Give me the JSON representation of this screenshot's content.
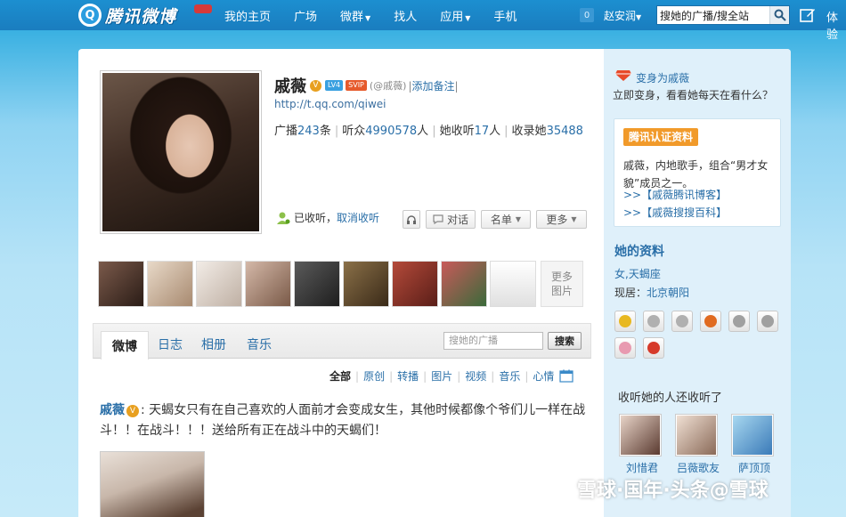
{
  "topbar": {
    "logo_text": "腾讯微博",
    "nav": [
      "我的主页",
      "广场",
      "微群",
      "找人",
      "应用",
      "手机"
    ],
    "nav_dropdowns": [
      false,
      false,
      true,
      false,
      true,
      false
    ],
    "notification_count": "0",
    "user_name": "赵安润",
    "search_value": "搜她的广播/搜全站",
    "experience_label": "体验"
  },
  "profile": {
    "name": "戚薇",
    "level_badge": "LV4",
    "vip_badge": "SVIP",
    "handle": "(@戚薇)",
    "add_note": "添加备注",
    "url": "http://t.qq.com/qiwei",
    "stats": [
      {
        "label": "广播",
        "value": "243",
        "unit": "条"
      },
      {
        "label": "听众",
        "value": "4990578",
        "unit": "人"
      },
      {
        "label": "她收听",
        "value": "17",
        "unit": "人"
      },
      {
        "label": "收录她",
        "value": "35488",
        "unit": ""
      }
    ],
    "follow_status": "已收听",
    "unfollow": "取消收听",
    "buttons": {
      "chat": "对话",
      "list": "名单",
      "more": "更多"
    }
  },
  "photos": {
    "more_line1": "更多",
    "more_line2": "图片",
    "tints": [
      "#7b5a4b",
      "#c9b6a3",
      "#d8cfc8",
      "#a88978",
      "#3d3a3a",
      "#6d5a3c",
      "#8e3a2f",
      "#a64a4a",
      "#f1f1f1"
    ]
  },
  "tabs": {
    "items": [
      "微博",
      "日志",
      "相册",
      "音乐"
    ],
    "active": 0,
    "search_placeholder": "搜她的广播",
    "search_button": "搜索"
  },
  "filters": [
    "全部",
    "原创",
    "转播",
    "图片",
    "视频",
    "音乐",
    "心情"
  ],
  "post": {
    "author": "戚薇",
    "text": ": 天蝎女只有在自己喜欢的人面前才会变成女生，其他时候都像个爷们儿一样在战斗！！在战斗！！！送给所有正在战斗中的天蝎们！"
  },
  "sidebar": {
    "switch_link": "变身为戚薇",
    "switch_desc": "立即变身，看看她每天在看什么？",
    "verify_tag": "腾讯认证资料",
    "verify_desc": "戚薇，内地歌手，组合“男才女貌”成员之一。",
    "verify_links": [
      ">>【戚薇腾讯博客】",
      ">>【戚薇搜搜百科】"
    ],
    "info_title": "她的资料",
    "info_gender": "女,天蝎座",
    "info_location_label": "现居：",
    "info_location": "北京朝阳",
    "medal_colors": [
      "#e8b820",
      "#b0b0b0",
      "#b0b0b0",
      "#e06a20",
      "#a0a0a0",
      "#a0a0a0",
      "#e89ab0",
      "#d63a2a"
    ],
    "also_title": "收听她的人还收听了",
    "fans": [
      {
        "name": "刘惜君",
        "tint": "#5a3a30"
      },
      {
        "name": "吕薇歌友",
        "tint": "#8a6a58"
      },
      {
        "name": "萨顶顶",
        "tint": "#3a7ab8"
      }
    ]
  },
  "watermark": "雪球·国年·头条@雪球"
}
